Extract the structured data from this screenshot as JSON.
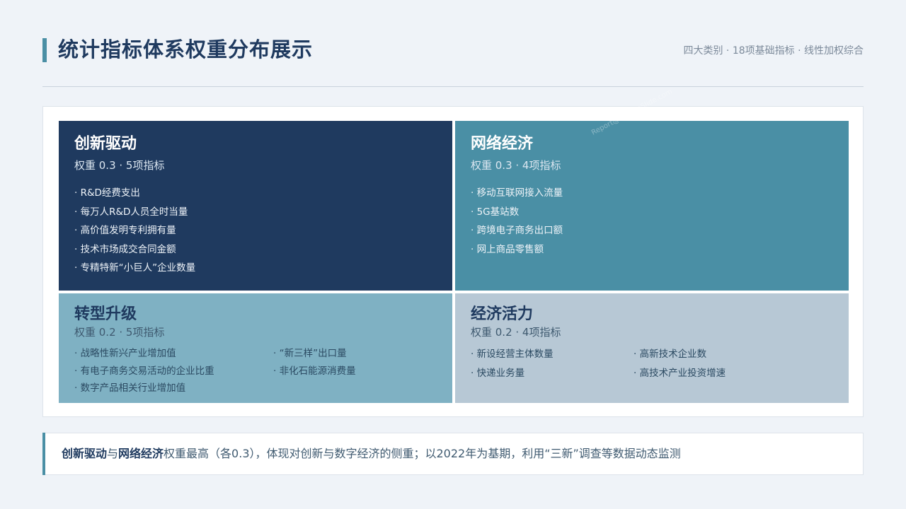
{
  "header": {
    "title": "统计指标体系权重分布展示",
    "subtitle": "四大类别 · 18项基础指标 · 线性加权综合"
  },
  "colors": {
    "navy": "#1f3a5f",
    "teal": "#4a8fa5",
    "light_teal": "#7fb1c3",
    "gray_blue": "#b7c8d5",
    "background": "#eff3f8"
  },
  "quadrants": [
    {
      "name": "创新驱动",
      "weight_text": "权重 0.3 · 5项指标",
      "items": [
        "R&D经费支出",
        "每万人R&D人员全时当量",
        "高价值发明专利拥有量",
        "技术市场成交合同金额",
        "专精特新“小巨人”企业数量"
      ]
    },
    {
      "name": "网络经济",
      "weight_text": "权重 0.3 · 4项指标",
      "items": [
        "移动互联网接入流量",
        "5G基站数",
        "跨境电子商务出口额",
        "网上商品零售额"
      ]
    },
    {
      "name": "转型升级",
      "weight_text": "权重 0.2 · 5项指标",
      "items": [
        "战略性新兴产业增加值",
        "有电子商务交易活动的企业比重",
        "数字产品相关行业增加值",
        "“新三样”出口量",
        "非化石能源消费量"
      ]
    },
    {
      "name": "经济活力",
      "weight_text": "权重 0.2 · 4项指标",
      "items": [
        "新设经营主体数量",
        "快递业务量",
        "高新技术企业数",
        "高技术产业投资增速"
      ]
    }
  ],
  "watermark": "Report@AiCubeSlide.com",
  "note": {
    "bold1": "创新驱动",
    "mid1": "与",
    "bold2": "网络经济",
    "rest": "权重最高（各0.3），体现对创新与数字经济的侧重；以2022年为基期，利用“三新”调查等数据动态监测"
  }
}
